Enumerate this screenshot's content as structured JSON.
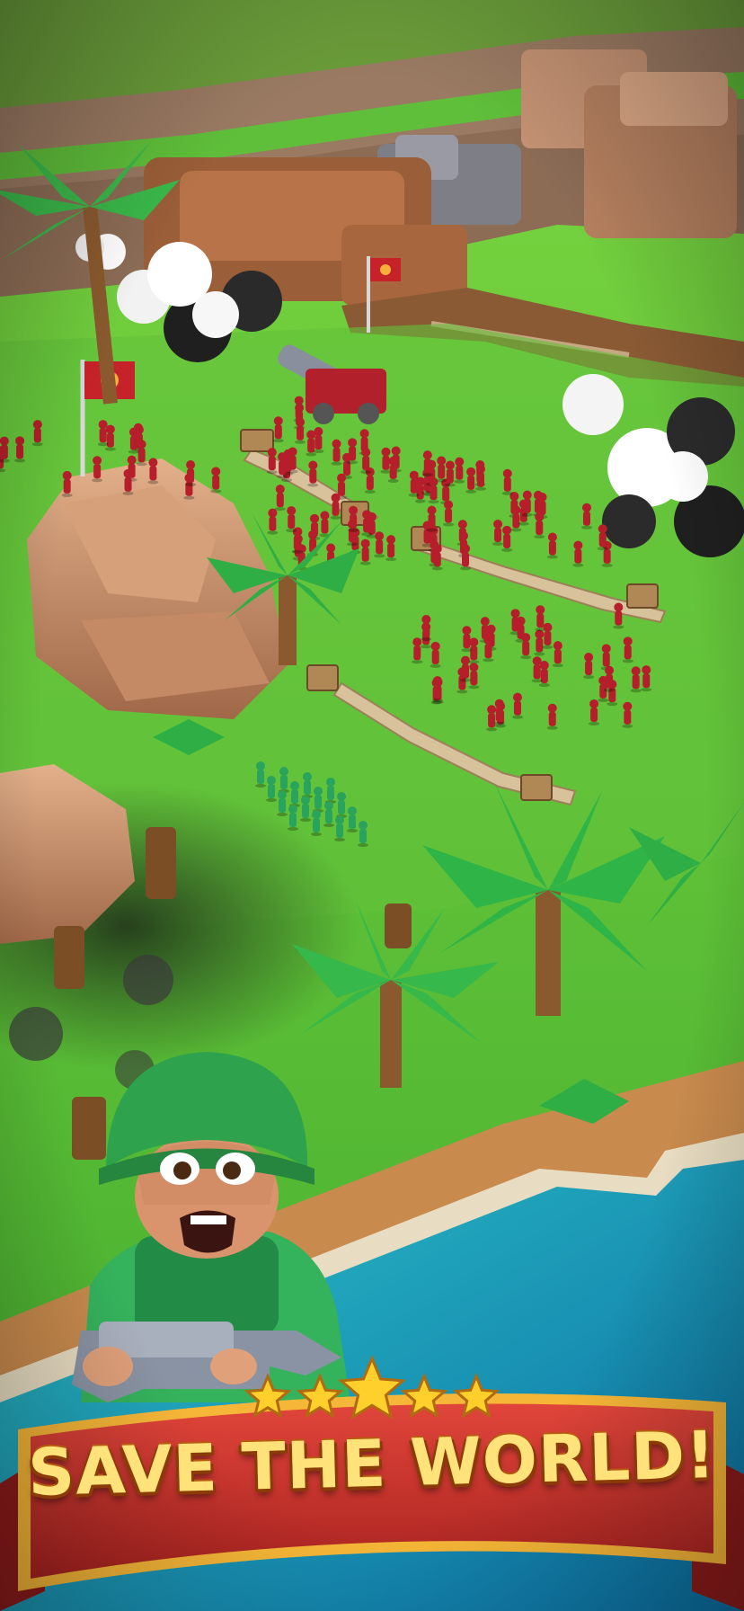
{
  "banner": {
    "title": "SAVE THE WORLD!",
    "stars": 5,
    "colors": {
      "ribbon": "#c9322a",
      "text": "#ffe27a",
      "trim": "#f6b637",
      "star": "#ffcf2b"
    }
  },
  "scene": {
    "enemy_army_color": "#b51e2a",
    "player_army_color": "#2aa35c",
    "flag_emblem": "spider-icon",
    "water_color": "#1aa6b7",
    "grass_color": "#5cc533"
  }
}
